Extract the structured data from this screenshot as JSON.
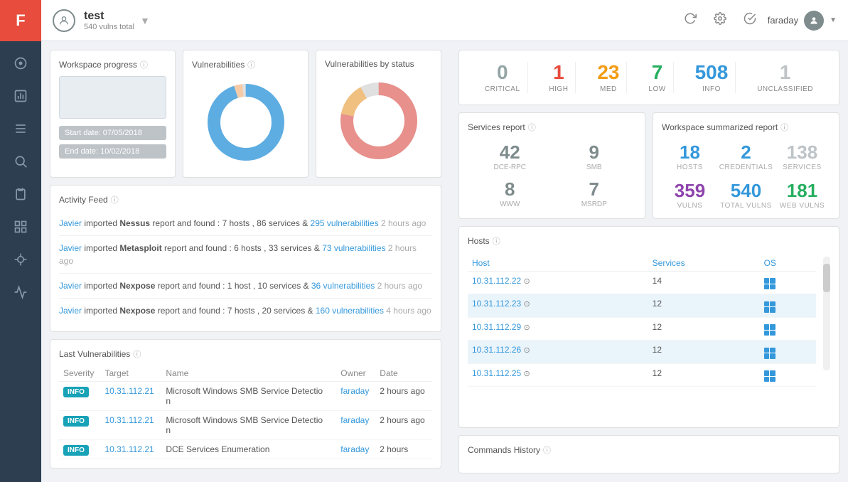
{
  "app": {
    "logo": "F",
    "user": "faraday",
    "workspace_name": "test",
    "workspace_subtitle": "540 vulns total"
  },
  "topbar": {
    "actions": [
      "refresh-icon",
      "settings-icon",
      "check-icon"
    ]
  },
  "sidebar": {
    "icons": [
      {
        "name": "dashboard-icon",
        "symbol": "⊙"
      },
      {
        "name": "reports-icon",
        "symbol": "📊"
      },
      {
        "name": "list-icon",
        "symbol": "☰"
      },
      {
        "name": "search-icon",
        "symbol": "🔍"
      },
      {
        "name": "clipboard-icon",
        "symbol": "📋"
      },
      {
        "name": "grid-icon",
        "symbol": "⊞"
      },
      {
        "name": "bug-icon",
        "symbol": "🐛"
      },
      {
        "name": "chart-icon",
        "symbol": "📈"
      }
    ]
  },
  "severity_summary": {
    "critical": {
      "value": "0",
      "label": "CRITICAL"
    },
    "high": {
      "value": "1",
      "label": "HIGH"
    },
    "med": {
      "value": "23",
      "label": "MED"
    },
    "low": {
      "value": "7",
      "label": "LOW"
    },
    "info": {
      "value": "508",
      "label": "INFO"
    },
    "unclassified": {
      "value": "1",
      "label": "UNCLASSIFIED"
    }
  },
  "workspace_progress": {
    "title": "Workspace progress",
    "start_date_label": "Start date: 07/05/2018",
    "end_date_label": "End date: 10/02/2018"
  },
  "vulnerabilities_donut": {
    "title": "Vulnerabilities"
  },
  "vulnerabilities_by_status": {
    "title": "Vulnerabilities by status"
  },
  "activity_feed": {
    "title": "Activity Feed",
    "items": [
      {
        "user": "Javier",
        "action": "imported",
        "tool": "Nessus",
        "text": "report and found : 7 hosts , 86 services &",
        "link_text": "295 vulnerabilities",
        "time": "2 hours ago"
      },
      {
        "user": "Javier",
        "action": "imported",
        "tool": "Metasploit",
        "text": "report and found : 6 hosts , 33 services &",
        "link_text": "73 vulnerabilities",
        "time": "2 hours ago"
      },
      {
        "user": "Javier",
        "action": "imported",
        "tool": "Nexpose",
        "text": "report and found : 1 host , 10 services &",
        "link_text": "36 vulnerabilities",
        "time": "2 hours ago"
      },
      {
        "user": "Javier",
        "action": "imported",
        "tool": "Nexpose",
        "text": "report and found : 7 hosts , 20 services &",
        "link_text": "160 vulnerabilities",
        "time": "4 hours ago"
      }
    ]
  },
  "last_vulnerabilities": {
    "title": "Last Vulnerabilities",
    "columns": [
      "Severity",
      "Target",
      "Name",
      "Owner",
      "Date"
    ],
    "rows": [
      {
        "severity": "INFO",
        "target": "10.31.112.21",
        "name": "Microsoft Windows SMB Service Detection",
        "owner": "faraday",
        "date": "2 hours ago"
      },
      {
        "severity": "INFO",
        "target": "10.31.112.21",
        "name": "Microsoft Windows SMB Service Detection",
        "owner": "faraday",
        "date": "2 hours ago"
      },
      {
        "severity": "INFO",
        "target": "10.31.112.21",
        "name": "DCE Services Enumeration",
        "owner": "faraday",
        "date": "2 hours"
      }
    ]
  },
  "services_report": {
    "title": "Services report",
    "items": [
      {
        "value": "42",
        "label": "DCE-RPC"
      },
      {
        "value": "9",
        "label": "SMB"
      },
      {
        "value": "8",
        "label": "WWW"
      },
      {
        "value": "7",
        "label": "MSRDP"
      }
    ]
  },
  "workspace_summary": {
    "title": "Workspace summarized report",
    "hosts": {
      "value": "18",
      "label": "HOSTS"
    },
    "credentials": {
      "value": "2",
      "label": "CREDENTIALS"
    },
    "services": {
      "value": "138",
      "label": "SERVICES"
    },
    "vulns": {
      "value": "359",
      "label": "VULNS"
    },
    "total_vulns": {
      "value": "540",
      "label": "TOTAL VULNS"
    },
    "web_vulns": {
      "value": "181",
      "label": "WEB VULNS"
    }
  },
  "hosts": {
    "title": "Hosts",
    "columns": [
      "Host",
      "Services",
      "OS"
    ],
    "rows": [
      {
        "ip": "10.31.112.22",
        "services": "14",
        "highlighted": false
      },
      {
        "ip": "10.31.112.23",
        "services": "12",
        "highlighted": true
      },
      {
        "ip": "10.31.112.29",
        "services": "12",
        "highlighted": false
      },
      {
        "ip": "10.31.112.26",
        "services": "12",
        "highlighted": true
      },
      {
        "ip": "10.31.112.25",
        "services": "12",
        "highlighted": false
      }
    ]
  },
  "commands_history": {
    "title": "Commands History"
  }
}
